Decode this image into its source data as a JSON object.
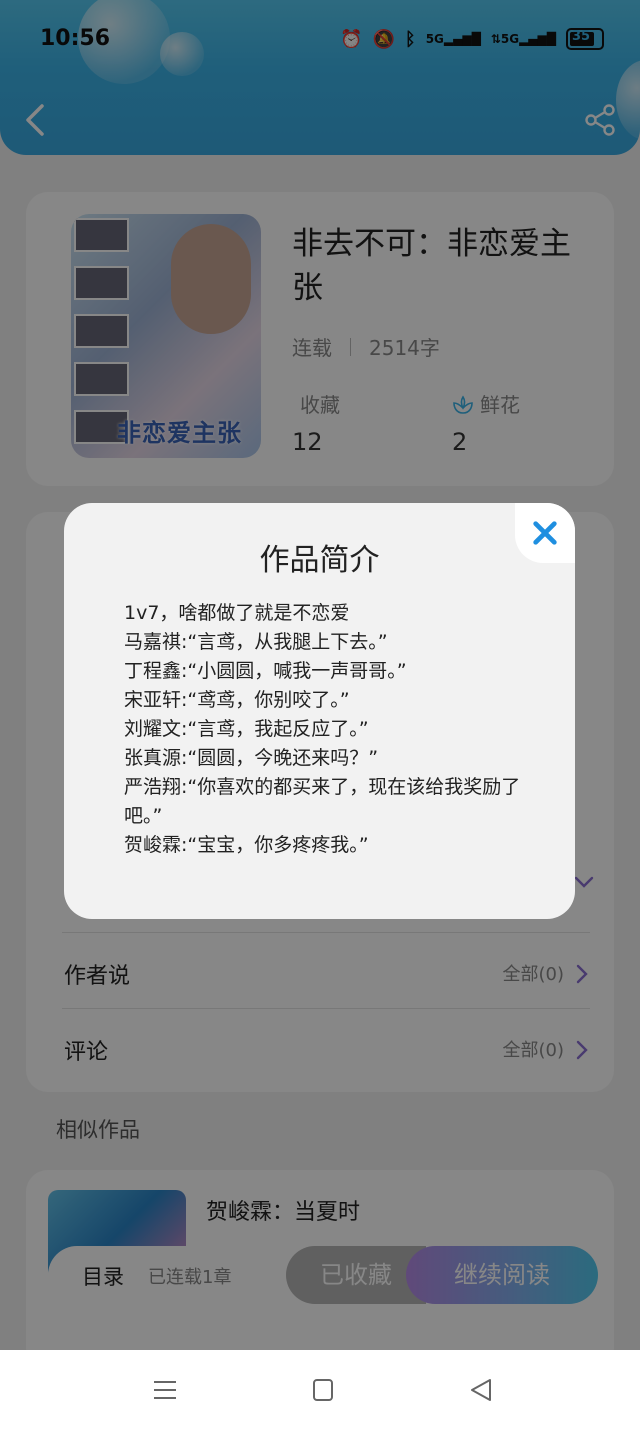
{
  "status_bar": {
    "time": "10:56",
    "battery": "35",
    "network": "5G"
  },
  "book": {
    "title": "非去不可：非恋爱主张",
    "cover_text": "非恋爱主张",
    "status": "连载",
    "word_count": "2514字",
    "favorites_label": "收藏",
    "favorites_count": "12",
    "flowers_label": "鲜花",
    "flowers_count": "2"
  },
  "rows": {
    "author_says": {
      "label": "作者说",
      "right": "全部(0)"
    },
    "comments": {
      "label": "评论",
      "right": "全部(0)"
    }
  },
  "similar": {
    "heading": "相似作品",
    "items": [
      {
        "title": "贺峻霖：当夏时"
      }
    ]
  },
  "bottom_bar": {
    "catalog": "目录",
    "progress": "已连载1章",
    "saved": "已收藏",
    "continue": "继续阅读"
  },
  "modal": {
    "title": "作品简介",
    "lines": [
      "1v7，啥都做了就是不恋爱",
      "马嘉祺:“言鸢，从我腿上下去。”",
      "丁程鑫:“小圆圆，喊我一声哥哥。”",
      "宋亚轩:“鸢鸢，你别咬了。”",
      "刘耀文:“言鸢，我起反应了。”",
      "张真源:“圆圆，今晚还来吗？”",
      "严浩翔:“你喜欢的都买来了，现在该给我奖励了吧。”",
      "贺峻霖:“宝宝，你多疼疼我。”"
    ]
  },
  "colors": {
    "accent_blue": "#3bb3e8",
    "close_blue": "#1f8fe0",
    "read_gradient_start": "#b58be6",
    "read_gradient_end": "#52c9ef"
  }
}
